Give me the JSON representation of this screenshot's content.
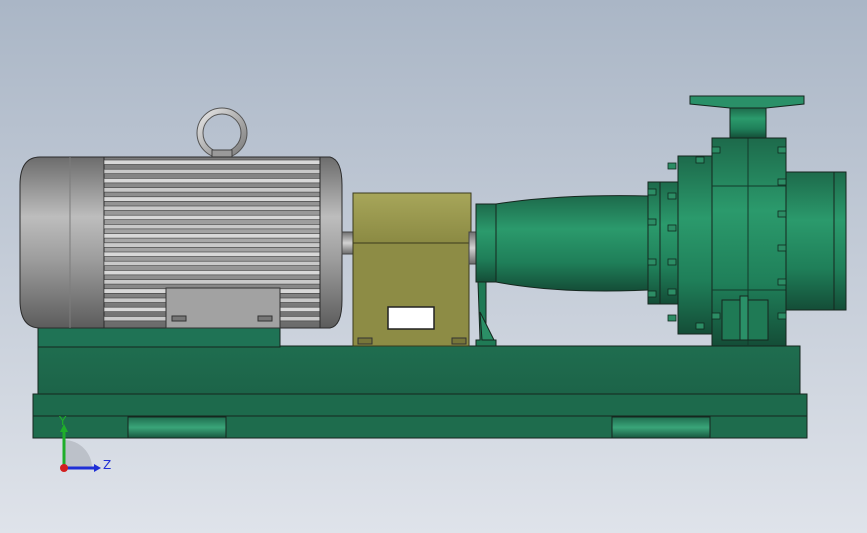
{
  "viewport": {
    "background_top": "#aab6c6",
    "background_bottom": "#dfe3ea"
  },
  "model": {
    "components": [
      "electric-motor",
      "lifting-eye",
      "coupling-guard",
      "pump-bearing-housing",
      "pump-casing",
      "base-frame"
    ],
    "colors": {
      "motor_gray": "#8f8f8f",
      "motor_light": "#cfcfcf",
      "guard_olive": "#9a9a4c",
      "pump_green": "#1f7f57",
      "base_green": "#217354",
      "edge": "#1b2a22"
    }
  },
  "triad": {
    "y_label": "Y",
    "z_label": "Z",
    "y_color": "#1fae2a",
    "z_color": "#1f2fd6",
    "x_color": "#d21f1f"
  }
}
